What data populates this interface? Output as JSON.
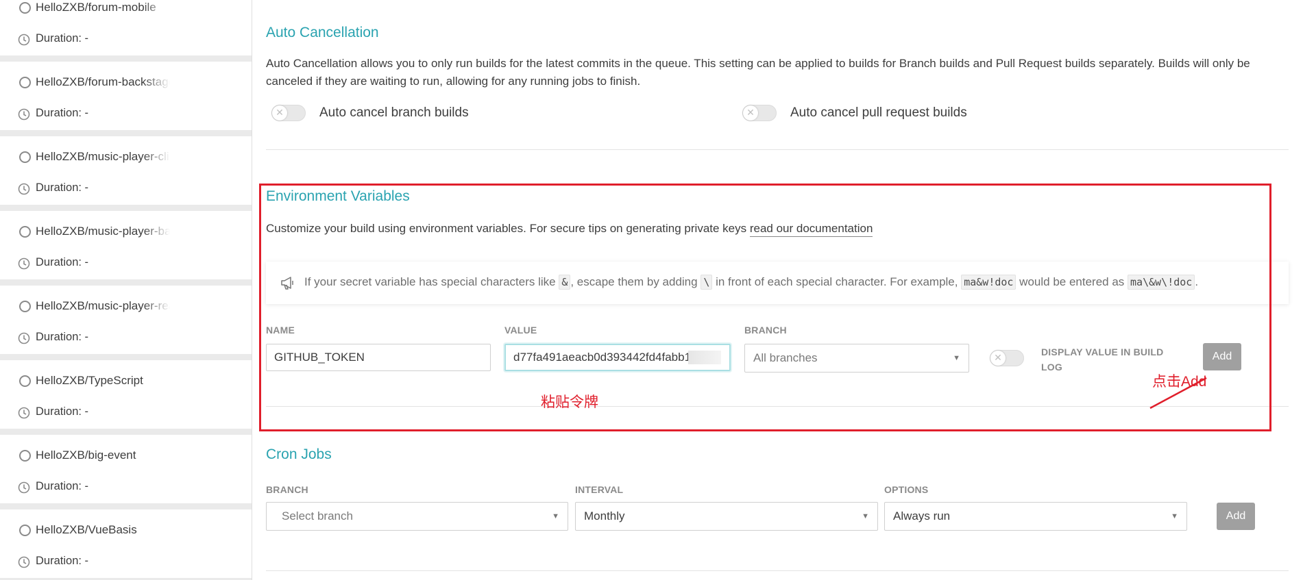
{
  "sidebar": {
    "repos": [
      {
        "name": "HelloZXB/forum-mobile",
        "duration": "Duration: -"
      },
      {
        "name": "HelloZXB/forum-backstage",
        "duration": "Duration: -"
      },
      {
        "name": "HelloZXB/music-player-client",
        "duration": "Duration: -"
      },
      {
        "name": "HelloZXB/music-player-backstage",
        "duration": "Duration: -"
      },
      {
        "name": "HelloZXB/music-player-rearEnd",
        "duration": "Duration: -"
      },
      {
        "name": "HelloZXB/TypeScript",
        "duration": "Duration: -"
      },
      {
        "name": "HelloZXB/big-event",
        "duration": "Duration: -"
      },
      {
        "name": "HelloZXB/VueBasis",
        "duration": "Duration: -"
      }
    ]
  },
  "auto_cancel": {
    "title": "Auto Cancellation",
    "description": "Auto Cancellation allows you to only run builds for the latest commits in the queue. This setting can be applied to builds for Branch builds and Pull Request builds separately. Builds will only be canceled if they are waiting to run, allowing for any running jobs to finish.",
    "branch_label": "Auto cancel branch builds",
    "pr_label": "Auto cancel pull request builds"
  },
  "env": {
    "title": "Environment Variables",
    "description": "Customize your build using environment variables. For secure tips on generating private keys ",
    "doc_link": "read our documentation",
    "notice": {
      "part1": "If your secret variable has special characters like ",
      "chip1": "&",
      "part2": ", escape them by adding ",
      "chip2": "\\",
      "part3": " in front of each special character. For example, ",
      "chip3": "ma&w!doc",
      "part4": " would be entered as ",
      "chip4": "ma\\&w\\!doc",
      "part5": "."
    },
    "name_label": "NAME",
    "name_value": "GITHUB_TOKEN",
    "value_label": "VALUE",
    "value_value": "d77fa491aeacb0d393442fd4fabb1",
    "branch_label": "BRANCH",
    "branch_value": "All branches",
    "display_label_line1": "DISPLAY VALUE IN BUILD",
    "display_label_line2": "LOG",
    "add_label": "Add"
  },
  "annotations": {
    "paste_token": "粘贴令牌",
    "click_add": "点击Add",
    "color": "#e01e2b"
  },
  "cron": {
    "title": "Cron Jobs",
    "branch_label": "BRANCH",
    "branch_placeholder": "Select branch",
    "interval_label": "INTERVAL",
    "interval_value": "Monthly",
    "options_label": "OPTIONS",
    "options_value": "Always run",
    "add_label": "Add"
  },
  "colors": {
    "accent": "#2aa3b0",
    "button_gray": "#a0a0a0"
  }
}
